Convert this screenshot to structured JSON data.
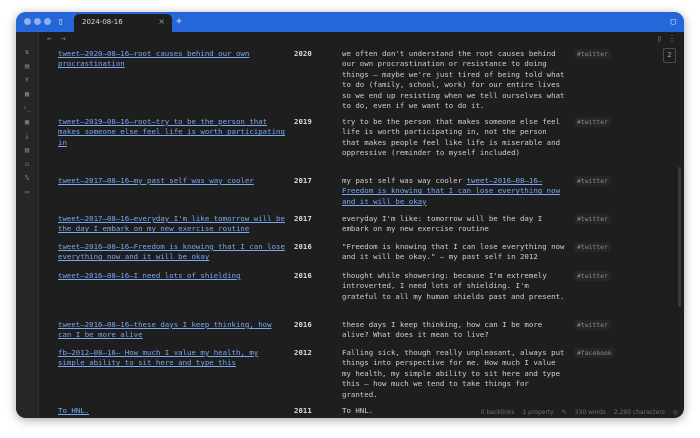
{
  "tab": {
    "title": "2024-08-16",
    "close": "×",
    "new_tab": "+"
  },
  "nav": {
    "back": "←",
    "forward": "→"
  },
  "page_indicator": "2",
  "rows": [
    {
      "link": "tweet–2020–08–16–root causes behind our own procrastination",
      "year": "2020",
      "text": "we often don't understand the root causes behind our own procrastination or resistance to doing things — maybe we're just tired of being told what to do (family, school, work) for our entire lives so we end up resisting when we tell ourselves what to do, even if we want to do it.",
      "tag": "#twitter"
    },
    {
      "link": "tweet–2019–08–16–root–try to be the person that makes someone else feel life is worth participating in",
      "year": "2019",
      "text": "try to be the person that makes someone else feel life is worth participating in, not the person that makes people feel like life is miserable and oppressive (reminder to myself included)",
      "tag": "#twitter"
    },
    {
      "link": "tweet–2017–08–16–my past self was way cooler",
      "year": "2017",
      "text_prefix": "my past self was way cooler ",
      "text_link": "tweet–2016–08–16–Freedom is knowing that I can lose everything now and it will be okay",
      "tag": "#twitter"
    },
    {
      "link": "tweet–2017–08–16–everyday I'm like tomorrow will be the day I embark on my new exercise routine",
      "year": "2017",
      "text": "everyday I'm like: tomorrow will be the day I embark on my new exercise routine",
      "tag": "#twitter"
    },
    {
      "link": "tweet–2016–08–16–Freedom is knowing that I can lose everything now and it will be okay",
      "year": "2016",
      "text": "\"Freedom is knowing that I can lose everything now and it will be okay.\" — my past self in 2012",
      "tag": "#twitter"
    },
    {
      "link": "tweet–2016–08–16–I need lots of shielding",
      "year": "2016",
      "text": "thought while showering: because I'm extremely introverted, I need lots of shielding. I'm grateful to all my human shields past and present.",
      "tag": "#twitter"
    },
    {
      "link": "tweet–2016–08–16–these days I keep thinking, how can I be more alive",
      "year": "2016",
      "text": "these days I keep thinking, how can I be more alive? What does it mean to live?",
      "tag": "#twitter"
    },
    {
      "link": "fb–2012–08–16– How much I value my health, my simple ability to sit here and type this",
      "year": "2012",
      "text": "Falling sick, though really unpleasant, always put things into perspective for me. How much I value my health, my simple ability to sit here and type this — how much we tend to take things for granted.",
      "tag": "#facebook"
    },
    {
      "link": "To HNL.",
      "year": "2011",
      "text": "To HNL.",
      "tag": ""
    }
  ],
  "status": {
    "backlinks": "0 backlinks",
    "properties": "1 property",
    "words": "330 words",
    "characters": "2,295 characters"
  }
}
